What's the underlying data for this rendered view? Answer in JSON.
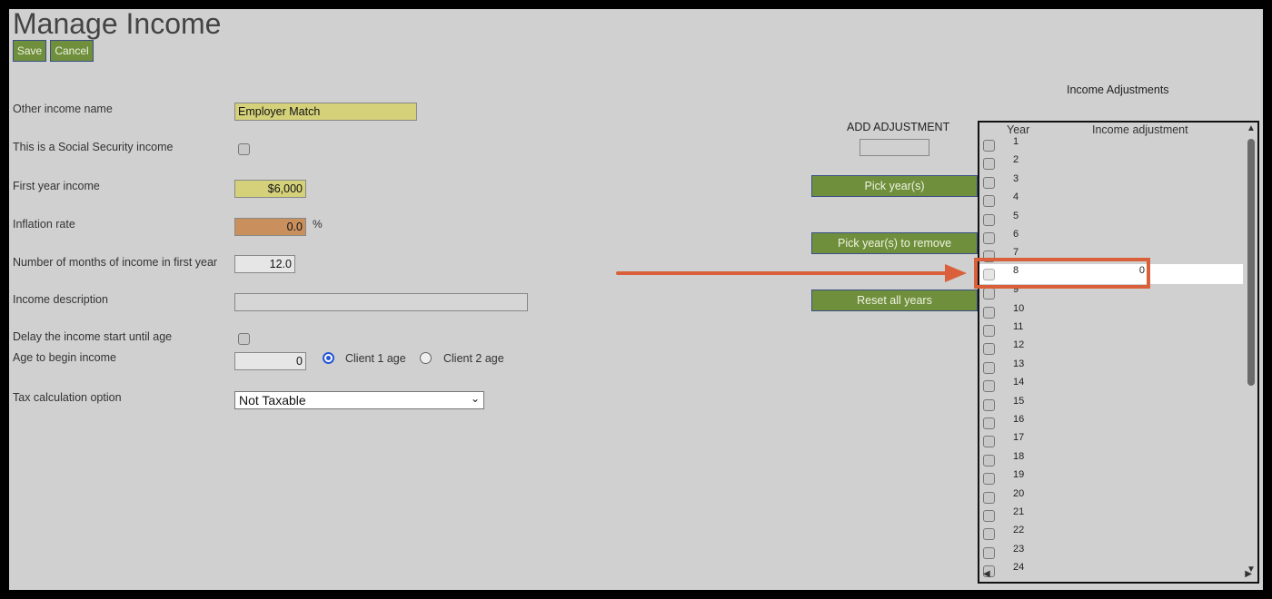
{
  "page": {
    "title": "Manage Income",
    "save_label": "Save",
    "cancel_label": "Cancel"
  },
  "form": {
    "other_income_name": {
      "label": "Other income name",
      "value": "Employer Match"
    },
    "social_security": {
      "label": "This is a Social Security income",
      "checked": false
    },
    "first_year_income": {
      "label": "First year income",
      "value": "$6,000"
    },
    "inflation_rate": {
      "label": "Inflation rate",
      "value": "0.0",
      "unit": "%"
    },
    "months_first_year": {
      "label": "Number of months of income in first year",
      "value": "12.0"
    },
    "income_description": {
      "label": "Income description",
      "value": ""
    },
    "delay_start": {
      "label": "Delay the income start until age",
      "checked": false
    },
    "begin_age": {
      "label": "Age to begin income",
      "value": "0",
      "client1_label": "Client 1 age",
      "client2_label": "Client 2 age",
      "selected": "Client 1 age"
    },
    "tax_option": {
      "label": "Tax calculation option",
      "selected": "Not Taxable"
    }
  },
  "adjustments": {
    "title": "Income Adjustments",
    "add_label": "ADD ADJUSTMENT",
    "pick_years_label": "Pick year(s)",
    "pick_remove_label": "Pick year(s) to remove",
    "reset_label": "Reset all years",
    "col_year": "Year",
    "col_adjustment": "Income adjustment",
    "rows": [
      {
        "year": "1"
      },
      {
        "year": "2"
      },
      {
        "year": "3"
      },
      {
        "year": "4"
      },
      {
        "year": "5"
      },
      {
        "year": "6"
      },
      {
        "year": "7"
      },
      {
        "year": "8",
        "value": "0",
        "highlighted": true
      },
      {
        "year": "9"
      },
      {
        "year": "10"
      },
      {
        "year": "11"
      },
      {
        "year": "12"
      },
      {
        "year": "13"
      },
      {
        "year": "14"
      },
      {
        "year": "15"
      },
      {
        "year": "16"
      },
      {
        "year": "17"
      },
      {
        "year": "18"
      },
      {
        "year": "19"
      },
      {
        "year": "20"
      },
      {
        "year": "21"
      },
      {
        "year": "22"
      },
      {
        "year": "23"
      },
      {
        "year": "24"
      }
    ]
  },
  "colors": {
    "button_green": "#6f8f3c",
    "highlight_orange": "#d9603a",
    "field_yellow": "#d4d17a",
    "field_orange": "#c9905e"
  }
}
